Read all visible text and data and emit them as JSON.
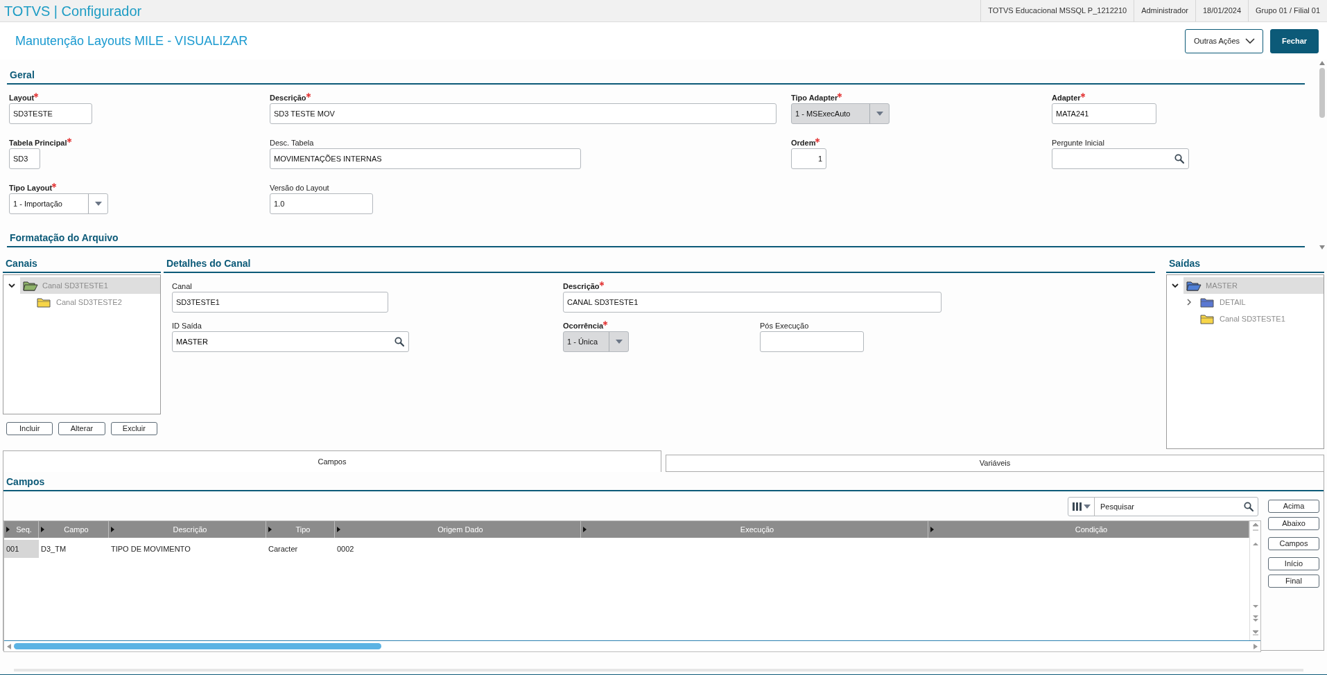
{
  "app_header": {
    "title": "TOTVS | Configurador",
    "info": [
      "TOTVS Educacional MSSQL P_1212210",
      "Administrador",
      "18/01/2024",
      "Grupo 01 / Filial 01"
    ]
  },
  "page": {
    "title": "Manutenção Layouts MILE - VISUALIZAR",
    "actions": [
      {
        "label": "Outras Ações",
        "kind": "dropdown"
      },
      {
        "label": "Fechar",
        "kind": "primary"
      }
    ]
  },
  "geral": {
    "title": "Geral",
    "rows": [
      [
        {
          "label": "Layout",
          "required": true,
          "kind": "text",
          "value": "SD3TESTE",
          "disabled": false
        },
        {
          "label": "Descrição",
          "required": true,
          "kind": "text",
          "value": "SD3 TESTE MOV",
          "disabled": false
        },
        {
          "label": "Tipo Adapter",
          "required": true,
          "kind": "select",
          "value": "1 - MSExecAuto",
          "disabled": true
        },
        {
          "label": "Adapter",
          "required": true,
          "kind": "text",
          "value": "MATA241",
          "disabled": false
        }
      ],
      [
        {
          "label": "Tabela Principal",
          "required": true,
          "kind": "text",
          "value": "SD3",
          "disabled": false
        },
        {
          "label": "Desc. Tabela",
          "required": false,
          "kind": "text",
          "value": "MOVIMENTAÇÕES INTERNAS",
          "disabled": false
        },
        {
          "label": "Ordem",
          "required": true,
          "kind": "number",
          "value": "1",
          "disabled": false
        },
        {
          "label": "Pergunte Inicial",
          "required": false,
          "kind": "lookup",
          "disabled": false
        }
      ],
      [
        {
          "label": "Tipo Layout",
          "required": true,
          "kind": "select",
          "value": "1 - Importação",
          "disabled": false
        },
        {
          "label": "Versão do Layout",
          "required": false,
          "kind": "text",
          "value": "1.0",
          "disabled": false
        }
      ]
    ]
  },
  "formatacao": {
    "title": "Formatação do Arquivo"
  },
  "canais": {
    "title": "Canais",
    "tree": [
      {
        "label": "Canal SD3TESTE1",
        "expanded": true,
        "selected": true,
        "color": "#8fb36a",
        "children": [
          {
            "label": "Canal SD3TESTE2",
            "selected": false,
            "color": "#f7d548"
          }
        ]
      }
    ],
    "buttons": [
      "Incluir",
      "Alterar",
      "Excluir"
    ]
  },
  "detalhes": {
    "title": "Detalhes do Canal",
    "rows": [
      [
        {
          "label": "Canal",
          "required": false,
          "kind": "text",
          "value": "SD3TESTE1",
          "disabled": false
        },
        {
          "label": "Descrição",
          "required": true,
          "kind": "text",
          "value": "CANAL SD3TESTE1",
          "disabled": false
        }
      ],
      [
        {
          "label": "ID Saída",
          "required": false,
          "kind": "lookup",
          "value": "MASTER",
          "disabled": false
        },
        {
          "label": "Ocorrência",
          "required": true,
          "kind": "select",
          "value": "1 - Única",
          "disabled": true
        },
        {
          "label": "Pós Execução",
          "required": false,
          "kind": "text",
          "disabled": false
        }
      ]
    ]
  },
  "saidas": {
    "title": "Saídas",
    "tree": [
      {
        "label": "MASTER",
        "expanded": true,
        "selected": true,
        "color": "#4f7fd6",
        "children": [
          {
            "label": "DETAIL",
            "expanded": false,
            "selected": false,
            "color": "#5a78d2"
          },
          {
            "label": "Canal SD3TESTE1",
            "selected": false,
            "color": "#f7d548"
          }
        ]
      }
    ]
  },
  "tabs": [
    {
      "label": "Campos",
      "selected": true
    },
    {
      "label": "Variáveis",
      "selected": false
    }
  ],
  "campos": {
    "title": "Campos",
    "search": {
      "placeholder": "Pesquisar"
    },
    "table": {
      "columns": [
        "Seq.",
        "Campo",
        "Descrição",
        "Tipo",
        "Origem Dado",
        "Execução",
        "Condição"
      ],
      "rows": [
        {
          "selected": true,
          "cells": [
            "001",
            "D3_TM",
            "TIPO DE MOVIMENTO",
            "Caracter",
            "0002",
            "",
            ""
          ]
        }
      ]
    },
    "button_groups": [
      [
        "Acima",
        "Abaixo"
      ],
      [
        "Campos"
      ],
      [
        "Início",
        "Final"
      ]
    ]
  }
}
